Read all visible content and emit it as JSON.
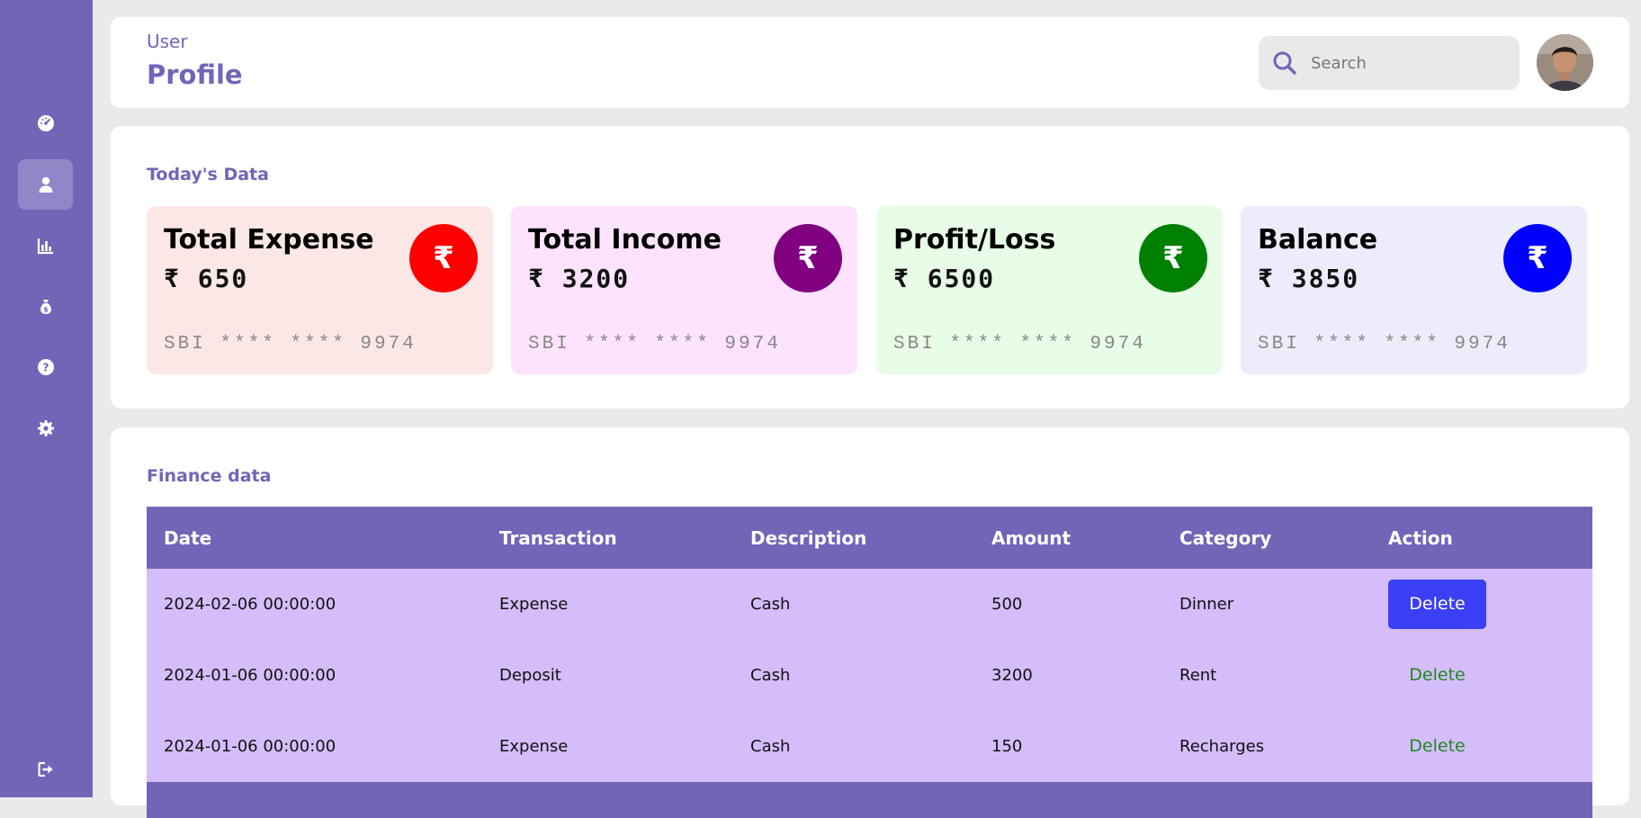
{
  "sidebar": {
    "items": [
      {
        "name": "dashboard",
        "icon": "gauge-icon",
        "active": false
      },
      {
        "name": "profile",
        "icon": "user-icon",
        "active": true
      },
      {
        "name": "analytics",
        "icon": "bar-chart-icon",
        "active": false
      },
      {
        "name": "finance",
        "icon": "money-bag-icon",
        "active": false
      },
      {
        "name": "help",
        "icon": "question-icon",
        "active": false
      },
      {
        "name": "settings",
        "icon": "gear-icon",
        "active": false
      }
    ],
    "logout_icon": "logout-icon"
  },
  "header": {
    "crumb": "User",
    "title": "Profile",
    "search_placeholder": "Search"
  },
  "today": {
    "title": "Today's Data",
    "cards": [
      {
        "title": "Total Expense",
        "amount": "₹ 650",
        "account": "SBI **** **** 9974",
        "coin_symbol": "₹",
        "bg": "#fbe7e6",
        "coin_color": "#ff0000"
      },
      {
        "title": "Total Income",
        "amount": "₹ 3200",
        "account": "SBI **** **** 9974",
        "coin_symbol": "₹",
        "bg": "#fde3fd",
        "coin_color": "#800080"
      },
      {
        "title": "Profit/Loss",
        "amount": "₹ 6500",
        "account": "SBI **** **** 9974",
        "coin_symbol": "₹",
        "bg": "#e8fde8",
        "coin_color": "#008000"
      },
      {
        "title": "Balance",
        "amount": "₹ 3850",
        "account": "SBI **** **** 9974",
        "coin_symbol": "₹",
        "bg": "#ececfc",
        "coin_color": "#0000ff"
      }
    ]
  },
  "finance": {
    "title": "Finance data",
    "columns": [
      "Date",
      "Transaction",
      "Description",
      "Amount",
      "Category",
      "Action"
    ],
    "rows": [
      {
        "date": "2024-02-06 00:00:00",
        "transaction": "Expense",
        "description": "Cash",
        "amount": "500",
        "category": "Dinner",
        "action": "Delete"
      },
      {
        "date": "2024-01-06 00:00:00",
        "transaction": "Deposit",
        "description": "Cash",
        "amount": "3200",
        "category": "Rent",
        "action": "Delete"
      },
      {
        "date": "2024-01-06 00:00:00",
        "transaction": "Expense",
        "description": "Cash",
        "amount": "150",
        "category": "Recharges",
        "action": "Delete"
      }
    ]
  },
  "colors": {
    "accent": "#7265b8",
    "row_bg": "#d5bdfb",
    "delete_primary": "#3b3ff5",
    "delete_link": "#1f8a1f"
  }
}
